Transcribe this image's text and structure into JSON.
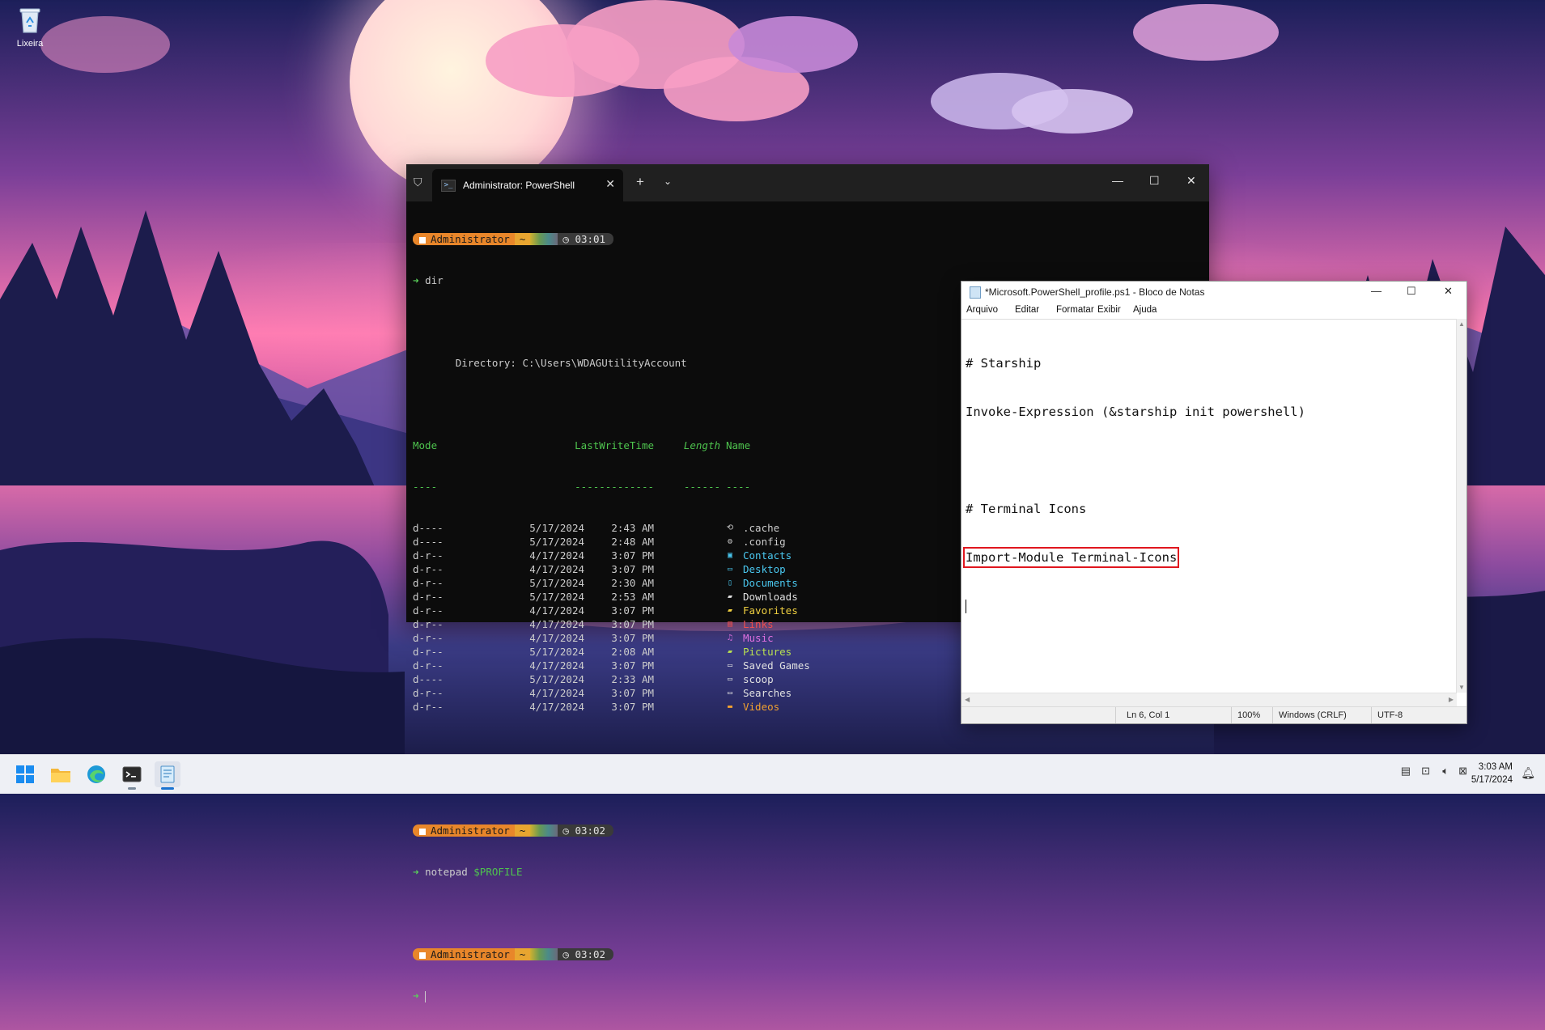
{
  "desktop": {
    "recycle_bin_label": "Lixeira"
  },
  "terminal": {
    "tab_title": "Administrator: PowerShell",
    "new_tab": "+",
    "dropdown": "⌄",
    "prompt_user": "Administrator",
    "prompt_dir": "~",
    "prompt_times": [
      "03:01",
      "03:02",
      "03:02"
    ],
    "prompt_symbol": "➜",
    "cmd1": "dir",
    "directory_label": "Directory: C:\\Users\\WDAGUtilityAccount",
    "headers": {
      "mode": "Mode",
      "lwt": "LastWriteTime",
      "length": "Length",
      "name": "Name"
    },
    "header_rules": {
      "mode": "----",
      "lwt": "-------------",
      "length": "------",
      "name": "----"
    },
    "entries": [
      {
        "mode": "d----",
        "date": "5/17/2024",
        "time": "2:43 AM",
        "icon": "⟲",
        "name": ".cache",
        "color": "#cccccc"
      },
      {
        "mode": "d----",
        "date": "5/17/2024",
        "time": "2:48 AM",
        "icon": "⚙",
        "name": ".config",
        "color": "#cccccc"
      },
      {
        "mode": "d-r--",
        "date": "4/17/2024",
        "time": "3:07 PM",
        "icon": "▣",
        "name": "Contacts",
        "color": "#4ac8f0"
      },
      {
        "mode": "d-r--",
        "date": "4/17/2024",
        "time": "3:07 PM",
        "icon": "▭",
        "name": "Desktop",
        "color": "#4ac8f0"
      },
      {
        "mode": "d-r--",
        "date": "5/17/2024",
        "time": "2:30 AM",
        "icon": "▯",
        "name": "Documents",
        "color": "#4ac8f0"
      },
      {
        "mode": "d-r--",
        "date": "5/17/2024",
        "time": "2:53 AM",
        "icon": "▰",
        "name": "Downloads",
        "color": "#e0e0e0"
      },
      {
        "mode": "d-r--",
        "date": "4/17/2024",
        "time": "3:07 PM",
        "icon": "▰",
        "name": "Favorites",
        "color": "#f0d040"
      },
      {
        "mode": "d-r--",
        "date": "4/17/2024",
        "time": "3:07 PM",
        "icon": "▤",
        "name": "Links",
        "color": "#f05050"
      },
      {
        "mode": "d-r--",
        "date": "4/17/2024",
        "time": "3:07 PM",
        "icon": "♫",
        "name": "Music",
        "color": "#e070e0"
      },
      {
        "mode": "d-r--",
        "date": "5/17/2024",
        "time": "2:08 AM",
        "icon": "▰",
        "name": "Pictures",
        "color": "#b8e050"
      },
      {
        "mode": "d-r--",
        "date": "4/17/2024",
        "time": "3:07 PM",
        "icon": "▭",
        "name": "Saved Games",
        "color": "#e0e0e0"
      },
      {
        "mode": "d----",
        "date": "5/17/2024",
        "time": "2:33 AM",
        "icon": "▭",
        "name": "scoop",
        "color": "#e0e0e0"
      },
      {
        "mode": "d-r--",
        "date": "4/17/2024",
        "time": "3:07 PM",
        "icon": "▭",
        "name": "Searches",
        "color": "#e0e0e0"
      },
      {
        "mode": "d-r--",
        "date": "4/17/2024",
        "time": "3:07 PM",
        "icon": "▬",
        "name": "Videos",
        "color": "#f0a030"
      }
    ],
    "cmd2": "notepad",
    "cmd2_arg": "$PROFILE"
  },
  "notepad": {
    "title": "*Microsoft.PowerShell_profile.ps1 - Bloco de Notas",
    "menu": [
      "Arquivo",
      "Editar",
      "Formatar",
      "Exibir",
      "Ajuda"
    ],
    "lines": [
      "# Starship",
      "Invoke-Expression (&starship init powershell)",
      "",
      "# Terminal Icons",
      "Import-Module Terminal-Icons"
    ],
    "status": {
      "position": "Ln 6, Col 1",
      "zoom": "100%",
      "eol": "Windows (CRLF)",
      "encoding": "UTF-8"
    }
  },
  "taskbar": {
    "time": "3:03 AM",
    "date": "5/17/2024"
  }
}
